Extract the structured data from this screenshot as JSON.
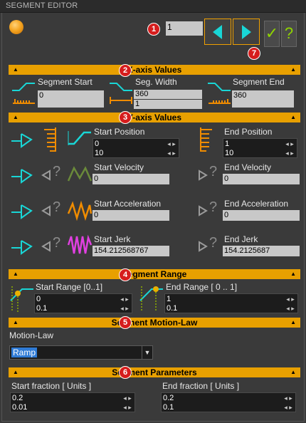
{
  "window": {
    "title": "SEGMENT EDITOR"
  },
  "nav": {
    "segment_index": "1",
    "ok_symbol": "✓",
    "help_symbol": "?"
  },
  "badges": [
    "1",
    "2",
    "3",
    "4",
    "5",
    "6",
    "7"
  ],
  "sections": {
    "x_axis": "X-axis Values",
    "y_axis": "Y-axis Values",
    "range": "Segment Range",
    "motion_law": "Segment Motion-Law",
    "params": "Segment Parameters"
  },
  "x_axis": {
    "start_label": "Segment Start",
    "start_value": "0",
    "width_label": "Seg. Width",
    "width_value_1": "360",
    "width_value_2": "1",
    "end_label": "Segment End",
    "end_value": "360"
  },
  "y_axis": {
    "start_position_label": "Start Position",
    "start_position_values": [
      "0",
      "10"
    ],
    "end_position_label": "End Position",
    "end_position_values": [
      "1",
      "10"
    ],
    "start_velocity_label": "Start Velocity",
    "start_velocity_value": "0",
    "end_velocity_label": "End Velocity",
    "end_velocity_value": "0",
    "start_accel_label": "Start Acceleration",
    "start_accel_value": "0",
    "end_accel_label": "End Acceleration",
    "end_accel_value": "0",
    "start_jerk_label": "Start Jerk",
    "start_jerk_value": "154.212568767",
    "end_jerk_label": "End Jerk",
    "end_jerk_value": "154.2125687",
    "unknown_mark": "?"
  },
  "range": {
    "start_label": "Start Range  [0..1]",
    "start_values": [
      "0",
      "0.1"
    ],
    "end_label": "End Range [ 0 .. 1]",
    "end_values": [
      "1",
      "0.1"
    ]
  },
  "motion_law": {
    "label": "Motion-Law",
    "selected": "Ramp"
  },
  "params": {
    "start_label": "Start fraction [ Units ]",
    "start_values": [
      "0.2",
      "0.01"
    ],
    "end_label": "End fraction [ Units ]",
    "end_values": [
      "0.2",
      "0.1"
    ]
  },
  "colors": {
    "accent": "#e8a000",
    "cyan": "#19d6d6",
    "orange": "#f08c00",
    "magenta": "#e040e0",
    "green": "#6a8a3a",
    "badge": "#d61d1d"
  }
}
